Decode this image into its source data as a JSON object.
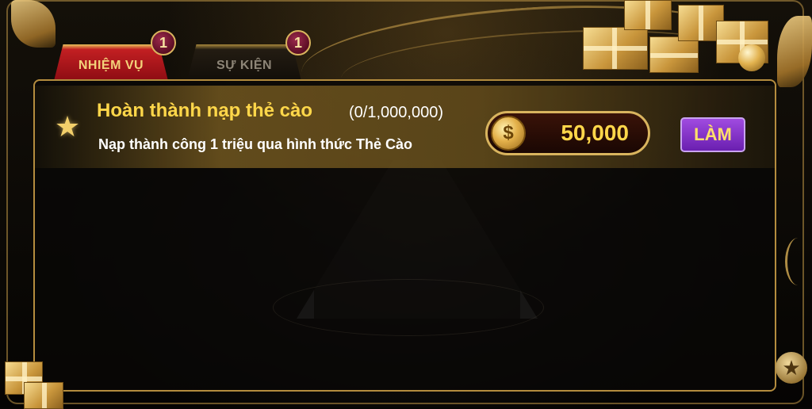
{
  "tabs": [
    {
      "label": "NHIỆM VỤ",
      "badge": "1",
      "active": true
    },
    {
      "label": "SỰ KIỆN",
      "badge": "1",
      "active": false
    }
  ],
  "task": {
    "icon": "star-icon",
    "title": "Hoàn thành nạp thẻ cào",
    "progress": "(0/1,000,000)",
    "description": "Nạp thành công 1 triệu qua hình thức Thẻ Cào",
    "reward_icon": "coin-icon",
    "reward_coin_symbol": "$",
    "reward_amount": "50,000",
    "action_label": "LÀM"
  },
  "colors": {
    "accent_gold": "#ffd74a",
    "tab_active": "#c21f22",
    "action_button": "#8a36c8"
  }
}
